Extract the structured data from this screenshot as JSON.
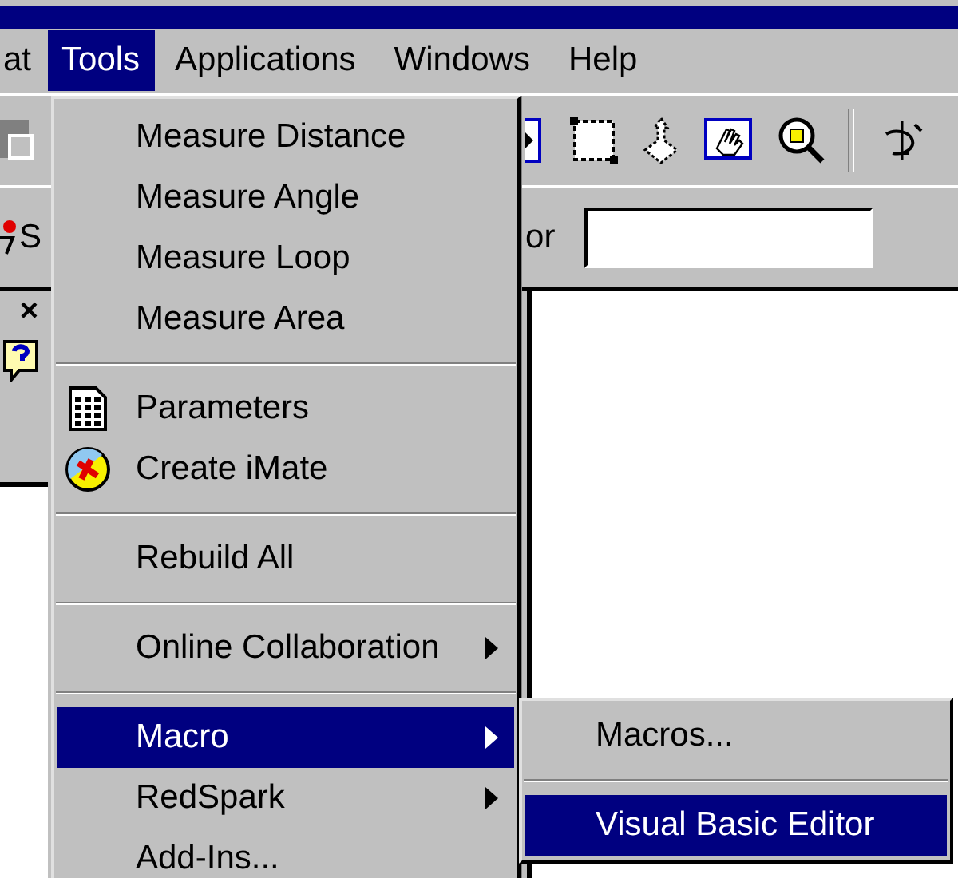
{
  "menu_bar": [
    {
      "label": "at",
      "selected": false
    },
    {
      "label": "Tools",
      "selected": true
    },
    {
      "label": "Applications",
      "selected": false
    },
    {
      "label": "Windows",
      "selected": false
    },
    {
      "label": "Help",
      "selected": false
    }
  ],
  "find_bar": {
    "left_label": "S",
    "label": "or"
  },
  "side_panel": {
    "close": "×"
  },
  "tools_menu": {
    "items": [
      {
        "kind": "item",
        "label": "Measure Distance",
        "selected": false,
        "submenu": false
      },
      {
        "kind": "item",
        "label": "Measure Angle",
        "selected": false,
        "submenu": false
      },
      {
        "kind": "item",
        "label": "Measure Loop",
        "selected": false,
        "submenu": false
      },
      {
        "kind": "item",
        "label": "Measure Area",
        "selected": false,
        "submenu": false
      },
      {
        "kind": "separator"
      },
      {
        "kind": "sheet",
        "label": "Parameters",
        "selected": false,
        "submenu": false
      },
      {
        "kind": "ball",
        "label": "Create iMate",
        "selected": false,
        "submenu": false
      },
      {
        "kind": "separator"
      },
      {
        "kind": "item",
        "label": "Rebuild All",
        "selected": false,
        "submenu": false
      },
      {
        "kind": "separator"
      },
      {
        "kind": "item",
        "label": "Online Collaboration",
        "selected": false,
        "submenu": true
      },
      {
        "kind": "separator"
      },
      {
        "kind": "item",
        "label": "Macro",
        "selected": true,
        "submenu": true
      },
      {
        "kind": "item",
        "label": "RedSpark",
        "selected": false,
        "submenu": true
      },
      {
        "kind": "item",
        "label": "Add-Ins...",
        "selected": false,
        "submenu": false
      }
    ]
  },
  "macro_submenu": {
    "items": [
      {
        "kind": "item",
        "label": "Macros...",
        "selected": false
      },
      {
        "kind": "separator"
      },
      {
        "kind": "item",
        "label": "Visual Basic Editor",
        "selected": true
      }
    ]
  }
}
